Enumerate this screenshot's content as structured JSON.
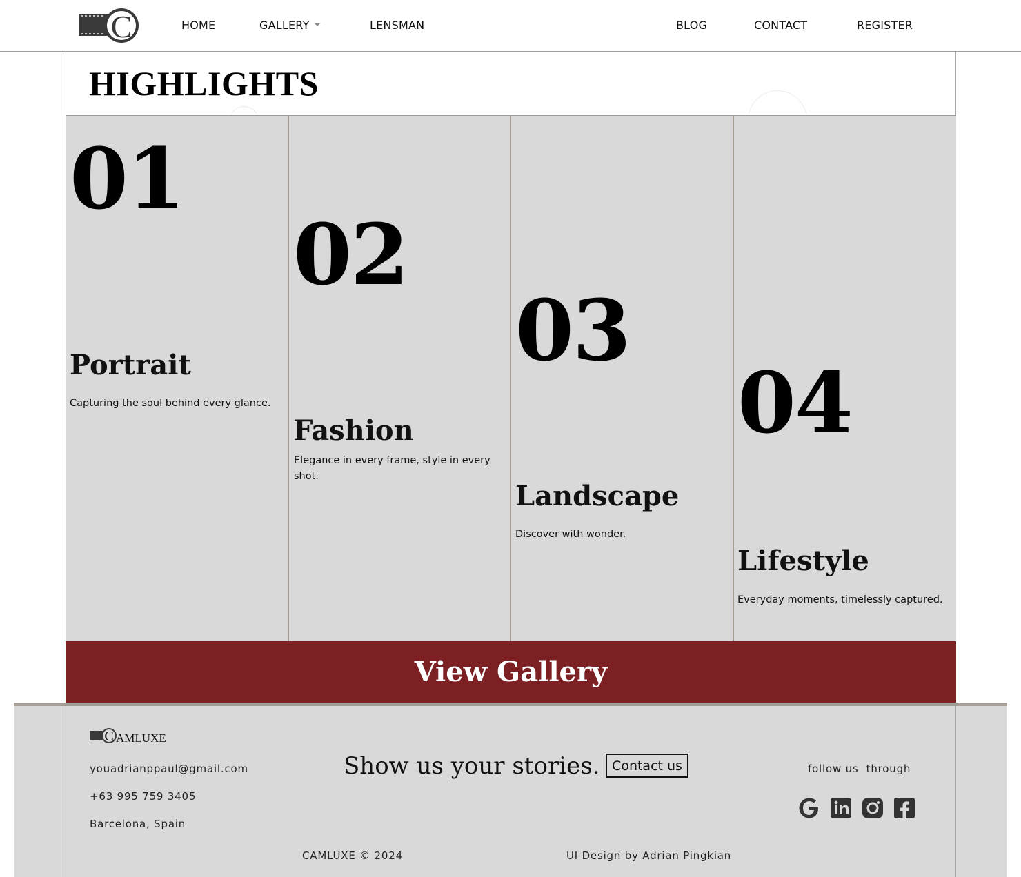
{
  "brand": {
    "logo_letter": "C",
    "footer_name": "AMLUXE"
  },
  "nav": {
    "home": "HOME",
    "gallery": "GALLERY",
    "lensman": "LENSMAN",
    "blog": "BLOG",
    "contact": "CONTACT",
    "register": "REGISTER"
  },
  "page_title": "HIGHLIGHTS",
  "highlights": [
    {
      "num": "01",
      "title": "Portrait",
      "desc": "Capturing the soul behind every glance."
    },
    {
      "num": "02",
      "title": "Fashion",
      "desc": "Elegance in every frame, style in every shot."
    },
    {
      "num": "03",
      "title": "Landscape",
      "desc": "Discover with wonder."
    },
    {
      "num": "04",
      "title": "Lifestyle",
      "desc": "Everyday moments, timelessly captured."
    }
  ],
  "cta": {
    "label": "View Gallery"
  },
  "footer": {
    "email": "youadrianppaul@gmail.com",
    "phone": "+63 995 759 3405",
    "location": "Barcelona, Spain",
    "tagline": "Show us your stories.",
    "contact_button": "Contact us",
    "follow": "follow us  through",
    "copyright": "CAMLUXE © 2024",
    "credit": "UI Design by Adrian Pingkian",
    "social_icons": [
      "google-icon",
      "linkedin-icon",
      "instagram-icon",
      "facebook-icon"
    ]
  },
  "colors": {
    "accent": "#7d2024",
    "panel": "#d9d9d9",
    "divider": "#a59e96",
    "icon": "#333333"
  }
}
